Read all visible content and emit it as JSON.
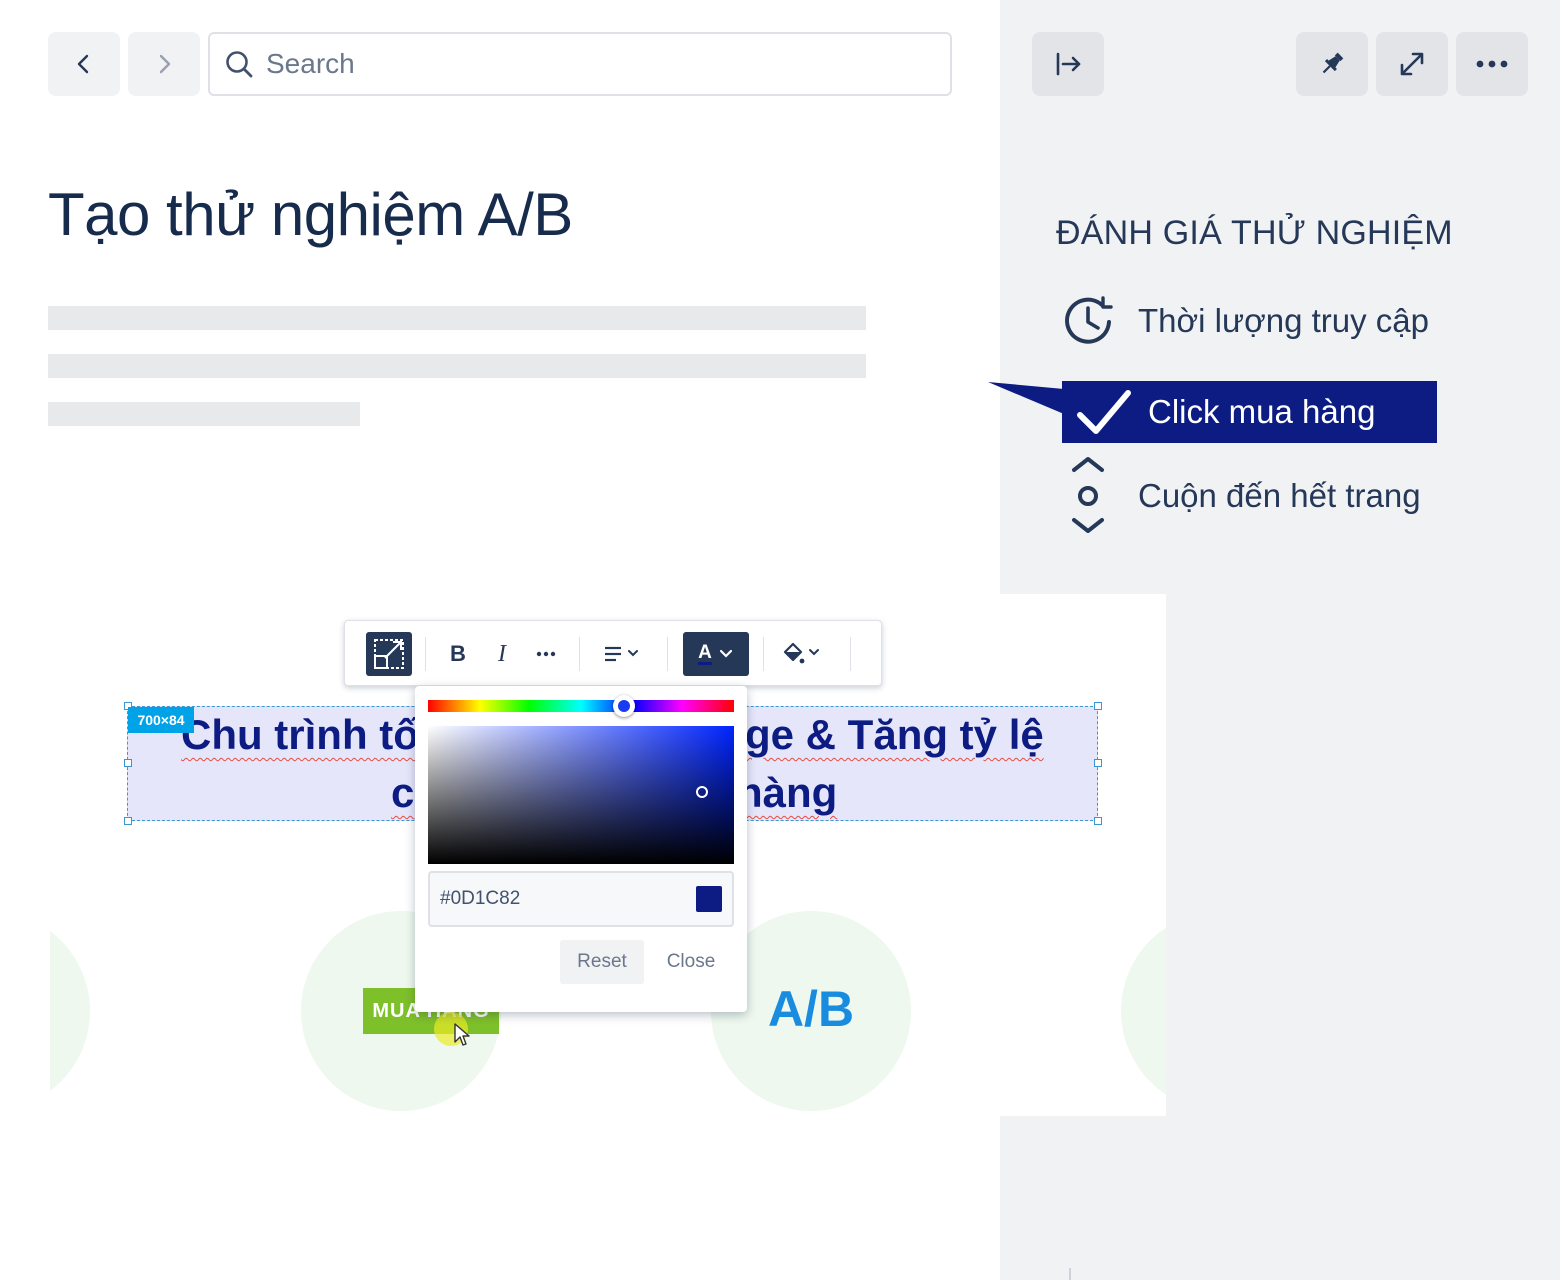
{
  "nav": {
    "back_icon": "chevron-left-icon",
    "forward_icon": "chevron-right-icon",
    "search": {
      "placeholder": "Search",
      "value": ""
    }
  },
  "page": {
    "title": "Tạo thử nghiệm A/B"
  },
  "right_panel": {
    "toolbar_icons": [
      "collapse-panel-icon",
      "pin-icon",
      "expand-icon",
      "more-icon"
    ],
    "heading": "ĐÁNH GIÁ THỬ NGHIỆM",
    "items": [
      {
        "label": "Thời lượng truy cập",
        "icon": "clock-icon",
        "selected": false
      },
      {
        "label": "Click mua hàng",
        "icon": "checkmark-icon",
        "selected": true
      },
      {
        "label": "Cuộn đến hết trang",
        "icon": "scroll-icon",
        "selected": false
      }
    ]
  },
  "editor": {
    "toolbar_buttons": [
      "resize-icon",
      "bold-icon",
      "italic-icon",
      "more-icon",
      "align-icon",
      "text-color-icon",
      "fill-color-icon"
    ],
    "bold_label": "B",
    "italic_label": "I",
    "text_color_label": "A",
    "selection_badge": "700×84",
    "heading_line1_left": "Chu trình tố",
    "heading_line1_right": "ge & Tăng tỷ lệ",
    "heading_line2_left": "c",
    "heading_line2_right": "hàng"
  },
  "color_picker": {
    "hex_value": "#0D1C82",
    "reset_label": "Reset",
    "close_label": "Close",
    "selected_color": "#0D1C82"
  },
  "canvas": {
    "buy_badge": "MUA HÀNG",
    "ab_label": "A/B"
  },
  "colors": {
    "accent": "#0d1c82",
    "panel_bg": "#f1f2f4",
    "badge_green": "#7ec02a",
    "ab_blue": "#1a8ce0"
  }
}
